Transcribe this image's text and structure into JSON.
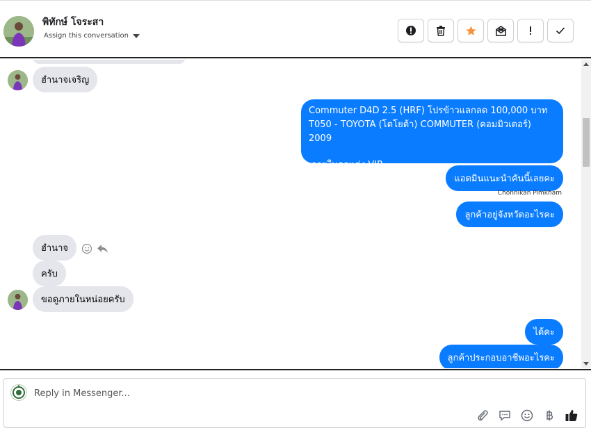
{
  "header": {
    "contact_name": "พิทักษ์ โจระสา",
    "assign_label": "Assign this conversation",
    "actions": [
      {
        "name": "mark-spam-button",
        "icon": "exclamation-circle-icon"
      },
      {
        "name": "delete-button",
        "icon": "trash-icon"
      },
      {
        "name": "star-button",
        "icon": "star-icon",
        "color": "#f7923b"
      },
      {
        "name": "mark-unread-button",
        "icon": "envelope-icon"
      },
      {
        "name": "flag-button",
        "icon": "exclamation-icon"
      },
      {
        "name": "mark-done-button",
        "icon": "check-icon"
      }
    ]
  },
  "messages": {
    "m1": "ฮำนาจเจริญ",
    "m2_line1": "Commuter D4D 2.5 (HRF) โปรข้าวแลกลด 100,000 บาท",
    "m2_line2": "T050 - TOYOTA (โตโยต้า) COMMUTER (คอมมิวเตอร์) 2009",
    "m2_line3": "ภายในตกแต่ง VIP",
    "m3": "แอดมินแนะนำคันนี้เลยคะ",
    "m3_sender": "Chonnikan Pimkham",
    "m4": "ลูกค้าอยู่จังหวัดอะไรคะ",
    "m5": "ฮำนาจ",
    "m6": "ครับ",
    "m7": "ขอดูภายในหน่อยครับ",
    "m8": "ได้คะ",
    "m9": "ลูกค้าประกอบอาชีพอะไรคะ"
  },
  "composer": {
    "placeholder": "Reply in Messenger...",
    "tools": [
      "paperclip-icon",
      "saved-reply-icon",
      "emoji-icon",
      "baht-icon",
      "thumbs-up-icon"
    ]
  },
  "colors": {
    "outgoing_bubble": "#0a7cff",
    "incoming_bubble": "#e4e6eb",
    "star": "#f7923b"
  }
}
